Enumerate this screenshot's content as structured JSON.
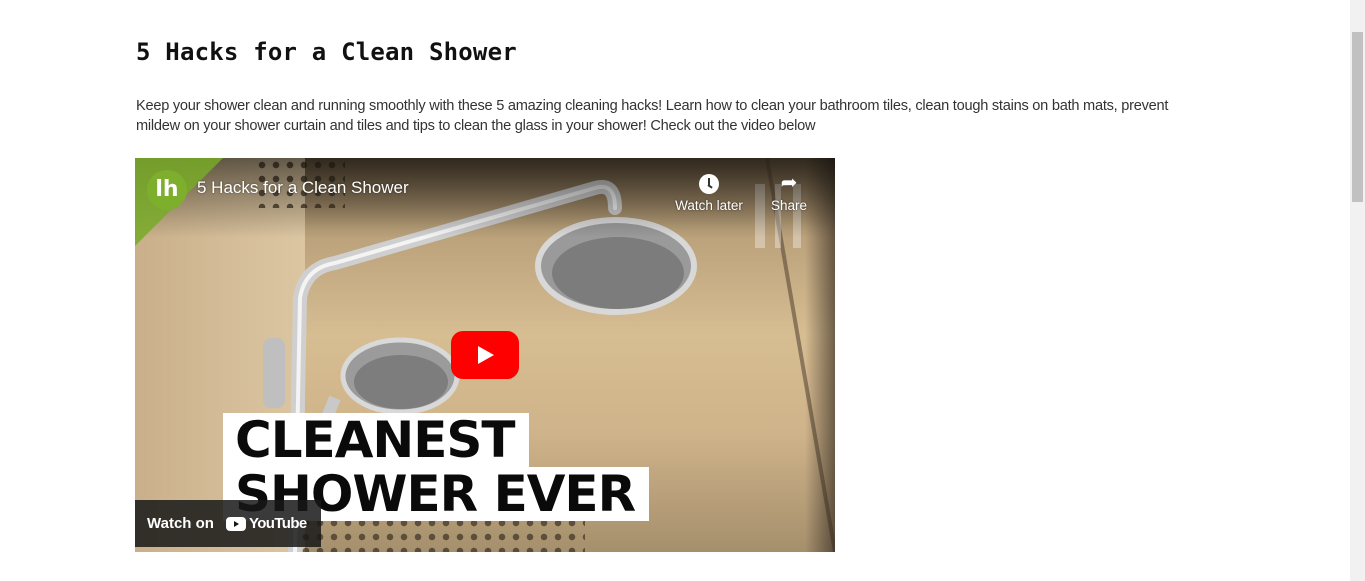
{
  "article": {
    "title": "5 Hacks for a Clean Shower",
    "body": "Keep your shower clean and running smoothly with these 5 amazing cleaning hacks! Learn how to clean your bathroom tiles, clean tough stains on bath mats, prevent mildew on your shower curtain and tiles and tips to clean the glass in your shower! Check out the video below"
  },
  "video": {
    "channel_logo": "lh",
    "title": "5 Hacks for a Clean Shower",
    "watch_later_label": "Watch later",
    "share_label": "Share",
    "overlay_line_1": "CLEANEST",
    "overlay_line_2": "SHOWER EVER",
    "watch_on_label": "Watch on",
    "youtube_label": "YouTube",
    "icons": {
      "watch_later": "clock-icon",
      "share": "share-arrow-icon",
      "play": "play-icon",
      "youtube": "youtube-logo-icon"
    },
    "colors": {
      "play_button": "#ff0000",
      "channel_logo": "#7dae2c"
    }
  }
}
